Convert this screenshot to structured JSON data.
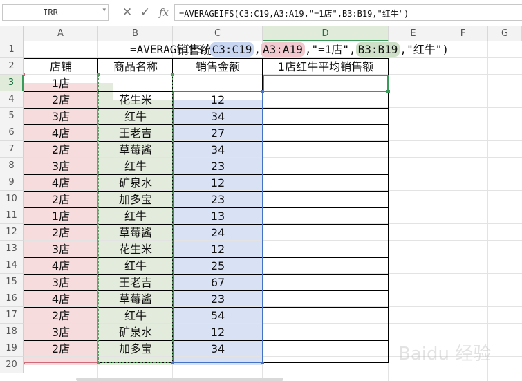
{
  "formula_bar": {
    "name_box": "IRR",
    "cancel_icon": "✕",
    "confirm_icon": "✓",
    "fx_label": "fx",
    "formula": "=AVERAGEIFS(C3:C19,A3:A19,\"=1店\",B3:B19,\"红牛\")"
  },
  "column_headers": [
    "A",
    "B",
    "C",
    "D",
    "E",
    "F",
    "G"
  ],
  "row_headers": [
    "1",
    "2",
    "3",
    "4",
    "5",
    "6",
    "7",
    "8",
    "9",
    "10",
    "11",
    "12",
    "13",
    "14",
    "15",
    "16",
    "17",
    "18",
    "19",
    "20"
  ],
  "active_cell": {
    "column": "D",
    "row": "3"
  },
  "sheet": {
    "title": "销售统计表",
    "headers": [
      "店铺",
      "商品名称",
      "销售金额",
      "1店红牛平均销售额"
    ],
    "rows": [
      {
        "store": "1店",
        "product": "",
        "amount": ""
      },
      {
        "store": "2店",
        "product": "花生米",
        "amount": "12"
      },
      {
        "store": "3店",
        "product": "红牛",
        "amount": "34"
      },
      {
        "store": "4店",
        "product": "王老吉",
        "amount": "27"
      },
      {
        "store": "2店",
        "product": "草莓酱",
        "amount": "34"
      },
      {
        "store": "3店",
        "product": "红牛",
        "amount": "23"
      },
      {
        "store": "4店",
        "product": "矿泉水",
        "amount": "12"
      },
      {
        "store": "2店",
        "product": "加多宝",
        "amount": "23"
      },
      {
        "store": "1店",
        "product": "红牛",
        "amount": "13"
      },
      {
        "store": "2店",
        "product": "草莓酱",
        "amount": "24"
      },
      {
        "store": "3店",
        "product": "花生米",
        "amount": "12"
      },
      {
        "store": "4店",
        "product": "红牛",
        "amount": "25"
      },
      {
        "store": "3店",
        "product": "王老吉",
        "amount": "67"
      },
      {
        "store": "4店",
        "product": "草莓酱",
        "amount": "23"
      },
      {
        "store": "2店",
        "product": "红牛",
        "amount": "54"
      },
      {
        "store": "3店",
        "product": "矿泉水",
        "amount": "12"
      },
      {
        "store": "2店",
        "product": "加多宝",
        "amount": "34"
      }
    ]
  },
  "in_cell_edit": {
    "prefix": "=AVERAGEIFS(",
    "ref1": "C3:C19",
    "sep1": ",",
    "ref2": "A3:A19",
    "crit1": ",\"=1店\",",
    "ref3": "B3:B19",
    "crit2": ",\"红牛\")"
  },
  "colors": {
    "range_a": "#f6dcdc",
    "range_b": "#e3ebdc",
    "range_c": "#d9e1f5",
    "selection_green": "#3a9a5a"
  },
  "watermark": "Baidu 经验"
}
